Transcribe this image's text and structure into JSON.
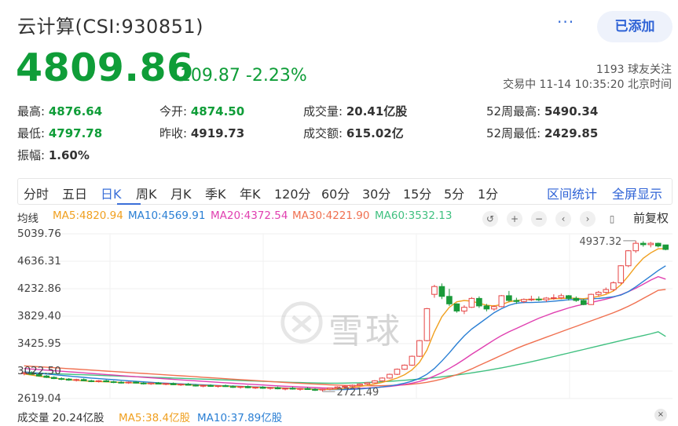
{
  "header": {
    "title": "云计算(CSI:930851)",
    "more": "···",
    "add_button": "已添加"
  },
  "quote": {
    "price": "4809.86",
    "change": "-109.87",
    "change_pct": "-2.23%",
    "followers": "1193 球友关注",
    "trade_status": "交易中 11-14 10:35:20 北京时间"
  },
  "stats": {
    "high_label": "最高:",
    "high": "4876.64",
    "open_label": "今开:",
    "open": "4874.50",
    "vol_label": "成交量:",
    "vol": "20.41亿股",
    "w52h_label": "52周最高:",
    "w52h": "5490.34",
    "low_label": "最低:",
    "low": "4797.78",
    "prev_label": "昨收:",
    "prev": "4919.73",
    "amt_label": "成交额:",
    "amt": "615.02亿",
    "w52l_label": "52周最低:",
    "w52l": "2429.85",
    "amp_label": "振幅:",
    "amp": "1.60%"
  },
  "tabs": [
    "分时",
    "五日",
    "日K",
    "周K",
    "月K",
    "季K",
    "年K",
    "120分",
    "60分",
    "30分",
    "15分",
    "5分",
    "1分"
  ],
  "tabs_active": "日K",
  "tabs_right": {
    "range_stats": "区间统计",
    "fullscreen": "全屏显示"
  },
  "ma_legend": {
    "mode": "均线",
    "ma5": "MA5:4820.94",
    "ma10": "MA10:4569.91",
    "ma20": "MA20:4372.54",
    "ma30": "MA30:4221.90",
    "ma60": "MA60:3532.13"
  },
  "controls": {
    "restore": "↺",
    "zoom_in": "+",
    "zoom_out": "−",
    "prev": "‹",
    "next": "›",
    "candle": "▯",
    "adjust": "前复权"
  },
  "chart_data": {
    "type": "candlestick",
    "y_ticks": [
      "5039.76",
      "4636.31",
      "4232.86",
      "3829.40",
      "3425.95",
      "3022.50",
      "2619.04"
    ],
    "ylim": [
      2619.04,
      5039.76
    ],
    "annotations": {
      "high": "4937.32",
      "low": "2721.49"
    },
    "colors": {
      "up": "#e64545",
      "down": "#1a9a3a",
      "ma5": "#f0a020",
      "ma10": "#2a7fd4",
      "ma20": "#e040b0",
      "ma30": "#f07050",
      "ma60": "#40c080"
    },
    "candles": [
      [
        2985,
        3010,
        2960,
        2998
      ],
      [
        2998,
        3020,
        2970,
        2975
      ],
      [
        2975,
        2990,
        2940,
        2950
      ],
      [
        2950,
        2965,
        2920,
        2930
      ],
      [
        2930,
        2945,
        2905,
        2912
      ],
      [
        2912,
        2930,
        2890,
        2905
      ],
      [
        2905,
        2920,
        2880,
        2890
      ],
      [
        2890,
        2910,
        2870,
        2898
      ],
      [
        2898,
        2915,
        2875,
        2880
      ],
      [
        2880,
        2895,
        2860,
        2870
      ],
      [
        2870,
        2890,
        2855,
        2880
      ],
      [
        2880,
        2895,
        2860,
        2866
      ],
      [
        2866,
        2880,
        2845,
        2858
      ],
      [
        2858,
        2875,
        2840,
        2850
      ],
      [
        2850,
        2870,
        2835,
        2860
      ],
      [
        2860,
        2875,
        2840,
        2846
      ],
      [
        2846,
        2860,
        2825,
        2835
      ],
      [
        2835,
        2855,
        2820,
        2848
      ],
      [
        2848,
        2862,
        2828,
        2832
      ],
      [
        2832,
        2850,
        2815,
        2840
      ],
      [
        2840,
        2855,
        2815,
        2822
      ],
      [
        2822,
        2840,
        2805,
        2830
      ],
      [
        2830,
        2848,
        2810,
        2815
      ],
      [
        2815,
        2832,
        2795,
        2805
      ],
      [
        2805,
        2822,
        2785,
        2812
      ],
      [
        2812,
        2828,
        2790,
        2798
      ],
      [
        2798,
        2815,
        2780,
        2808
      ],
      [
        2808,
        2825,
        2790,
        2795
      ],
      [
        2795,
        2812,
        2775,
        2785
      ],
      [
        2785,
        2802,
        2765,
        2795
      ],
      [
        2795,
        2810,
        2770,
        2778
      ],
      [
        2778,
        2795,
        2760,
        2785
      ],
      [
        2785,
        2800,
        2762,
        2770
      ],
      [
        2770,
        2790,
        2750,
        2780
      ],
      [
        2780,
        2795,
        2755,
        2762
      ],
      [
        2762,
        2780,
        2740,
        2770
      ],
      [
        2770,
        2790,
        2750,
        2758
      ],
      [
        2758,
        2775,
        2735,
        2766
      ],
      [
        2766,
        2785,
        2748,
        2752
      ],
      [
        2752,
        2770,
        2730,
        2745
      ],
      [
        2745,
        2765,
        2721,
        2758
      ],
      [
        2758,
        2780,
        2740,
        2775
      ],
      [
        2775,
        2800,
        2760,
        2790
      ],
      [
        2790,
        2815,
        2775,
        2800
      ],
      [
        2800,
        2825,
        2785,
        2815
      ],
      [
        2815,
        2840,
        2800,
        2832
      ],
      [
        2832,
        2860,
        2820,
        2850
      ],
      [
        2850,
        2890,
        2840,
        2880
      ],
      [
        2880,
        2930,
        2870,
        2920
      ],
      [
        2920,
        2985,
        2910,
        2975
      ],
      [
        2975,
        3060,
        2965,
        3050
      ],
      [
        3050,
        3120,
        3040,
        3110
      ],
      [
        3110,
        3250,
        3100,
        3240
      ],
      [
        3240,
        3480,
        3230,
        3470
      ],
      [
        3470,
        3950,
        3460,
        3940
      ],
      [
        4150,
        4290,
        4100,
        4265
      ],
      [
        4265,
        4310,
        4080,
        4120
      ],
      [
        4120,
        4230,
        3980,
        4010
      ],
      [
        4010,
        4020,
        3880,
        3905
      ],
      [
        3905,
        3990,
        3860,
        3960
      ],
      [
        3960,
        4110,
        3950,
        4090
      ],
      [
        4090,
        4120,
        3950,
        3980
      ],
      [
        3980,
        4010,
        3900,
        3935
      ],
      [
        3935,
        3990,
        3910,
        3970
      ],
      [
        3970,
        4140,
        3960,
        4130
      ],
      [
        4130,
        4200,
        4040,
        4060
      ],
      [
        4060,
        4100,
        4010,
        4045
      ],
      [
        4045,
        4090,
        4020,
        4075
      ],
      [
        4075,
        4130,
        4050,
        4080
      ],
      [
        4080,
        4120,
        4050,
        4070
      ],
      [
        4070,
        4110,
        4040,
        4095
      ],
      [
        4095,
        4150,
        4070,
        4100
      ],
      [
        4100,
        4160,
        4080,
        4130
      ],
      [
        4130,
        4140,
        4060,
        4090
      ],
      [
        4090,
        4120,
        4040,
        4060
      ],
      [
        4060,
        4085,
        3990,
        4000
      ],
      [
        4000,
        4160,
        3995,
        4150
      ],
      [
        4150,
        4200,
        4120,
        4180
      ],
      [
        4180,
        4250,
        4160,
        4220
      ],
      [
        4220,
        4340,
        4200,
        4320
      ],
      [
        4320,
        4580,
        4300,
        4570
      ],
      [
        4570,
        4800,
        4550,
        4790
      ],
      [
        4790,
        4937,
        4760,
        4900
      ],
      [
        4900,
        4930,
        4850,
        4880
      ],
      [
        4880,
        4920,
        4840,
        4900
      ],
      [
        4900,
        4910,
        4840,
        4860
      ],
      [
        4876,
        4877,
        4798,
        4810
      ]
    ],
    "ma5": [
      2980,
      2965,
      2948,
      2933,
      2920,
      2908,
      2896,
      2888,
      2880,
      2872,
      2868,
      2864,
      2860,
      2856,
      2852,
      2848,
      2843,
      2839,
      2835,
      2832,
      2828,
      2824,
      2820,
      2816,
      2812,
      2808,
      2804,
      2800,
      2796,
      2792,
      2789,
      2785,
      2782,
      2778,
      2774,
      2770,
      2766,
      2762,
      2758,
      2754,
      2752,
      2754,
      2760,
      2770,
      2782,
      2796,
      2812,
      2832,
      2856,
      2886,
      2920,
      2970,
      3040,
      3150,
      3330,
      3600,
      3820,
      3960,
      4040,
      4060,
      4050,
      4020,
      3990,
      3980,
      4000,
      4040,
      4060,
      4070,
      4075,
      4078,
      4080,
      4085,
      4090,
      4095,
      4092,
      4085,
      4100,
      4120,
      4150,
      4200,
      4290,
      4420,
      4560,
      4680,
      4760,
      4820,
      4821
    ],
    "ma10": [
      3010,
      3000,
      2990,
      2980,
      2970,
      2960,
      2950,
      2940,
      2930,
      2920,
      2912,
      2904,
      2896,
      2888,
      2880,
      2872,
      2865,
      2858,
      2851,
      2845,
      2840,
      2835,
      2830,
      2825,
      2820,
      2815,
      2810,
      2806,
      2802,
      2798,
      2794,
      2790,
      2786,
      2782,
      2778,
      2774,
      2770,
      2766,
      2762,
      2758,
      2755,
      2752,
      2751,
      2752,
      2755,
      2760,
      2768,
      2778,
      2790,
      2805,
      2822,
      2845,
      2875,
      2915,
      2975,
      3060,
      3170,
      3290,
      3420,
      3540,
      3640,
      3720,
      3800,
      3880,
      3940,
      3990,
      4020,
      4030,
      4030,
      4035,
      4040,
      4050,
      4060,
      4070,
      4075,
      4080,
      4085,
      4090,
      4100,
      4115,
      4140,
      4190,
      4260,
      4340,
      4420,
      4500,
      4570
    ],
    "ma20": [
      3060,
      3052,
      3044,
      3036,
      3028,
      3020,
      3012,
      3004,
      2996,
      2988,
      2980,
      2972,
      2964,
      2956,
      2948,
      2940,
      2932,
      2924,
      2916,
      2908,
      2900,
      2893,
      2886,
      2879,
      2872,
      2865,
      2858,
      2851,
      2844,
      2837,
      2830,
      2824,
      2818,
      2812,
      2806,
      2800,
      2795,
      2790,
      2785,
      2780,
      2776,
      2772,
      2770,
      2768,
      2768,
      2770,
      2774,
      2780,
      2788,
      2798,
      2810,
      2825,
      2845,
      2870,
      2905,
      2950,
      3000,
      3060,
      3125,
      3195,
      3270,
      3340,
      3410,
      3480,
      3545,
      3600,
      3650,
      3700,
      3750,
      3800,
      3840,
      3880,
      3915,
      3950,
      3980,
      4005,
      4030,
      4055,
      4080,
      4110,
      4145,
      4190,
      4240,
      4300,
      4360,
      4410,
      4373
    ],
    "ma30": [
      3100,
      3093,
      3086,
      3079,
      3072,
      3065,
      3058,
      3051,
      3044,
      3037,
      3030,
      3023,
      3016,
      3009,
      3002,
      2995,
      2988,
      2981,
      2974,
      2967,
      2960,
      2953,
      2946,
      2939,
      2932,
      2925,
      2918,
      2911,
      2904,
      2897,
      2890,
      2883,
      2876,
      2869,
      2862,
      2855,
      2849,
      2843,
      2837,
      2831,
      2826,
      2821,
      2817,
      2813,
      2810,
      2808,
      2807,
      2807,
      2808,
      2811,
      2815,
      2821,
      2830,
      2842,
      2858,
      2880,
      2905,
      2935,
      2970,
      3010,
      3055,
      3105,
      3155,
      3205,
      3255,
      3305,
      3355,
      3400,
      3440,
      3480,
      3520,
      3560,
      3600,
      3640,
      3680,
      3720,
      3760,
      3800,
      3840,
      3880,
      3925,
      3975,
      4030,
      4090,
      4150,
      4210,
      4222
    ],
    "ma60": [
      3000,
      2996,
      2992,
      2988,
      2984,
      2980,
      2976,
      2972,
      2968,
      2964,
      2960,
      2956,
      2952,
      2948,
      2944,
      2940,
      2936,
      2932,
      2928,
      2924,
      2920,
      2916,
      2912,
      2908,
      2904,
      2900,
      2896,
      2892,
      2888,
      2884,
      2880,
      2876,
      2872,
      2868,
      2864,
      2860,
      2857,
      2854,
      2851,
      2848,
      2846,
      2845,
      2845,
      2846,
      2848,
      2851,
      2855,
      2860,
      2866,
      2873,
      2880,
      2888,
      2896,
      2905,
      2915,
      2926,
      2938,
      2951,
      2965,
      2980,
      2996,
      3013,
      3031,
      3050,
      3070,
      3091,
      3113,
      3136,
      3160,
      3185,
      3210,
      3236,
      3262,
      3288,
      3314,
      3340,
      3366,
      3392,
      3418,
      3444,
      3470,
      3496,
      3520,
      3545,
      3570,
      3600,
      3532
    ]
  },
  "volume_legend": {
    "vol": "成交量 20.24亿股",
    "ma5": "MA5:38.4亿股",
    "ma10": "MA10:37.89亿股",
    "close": "×"
  },
  "watermark": "雪球"
}
